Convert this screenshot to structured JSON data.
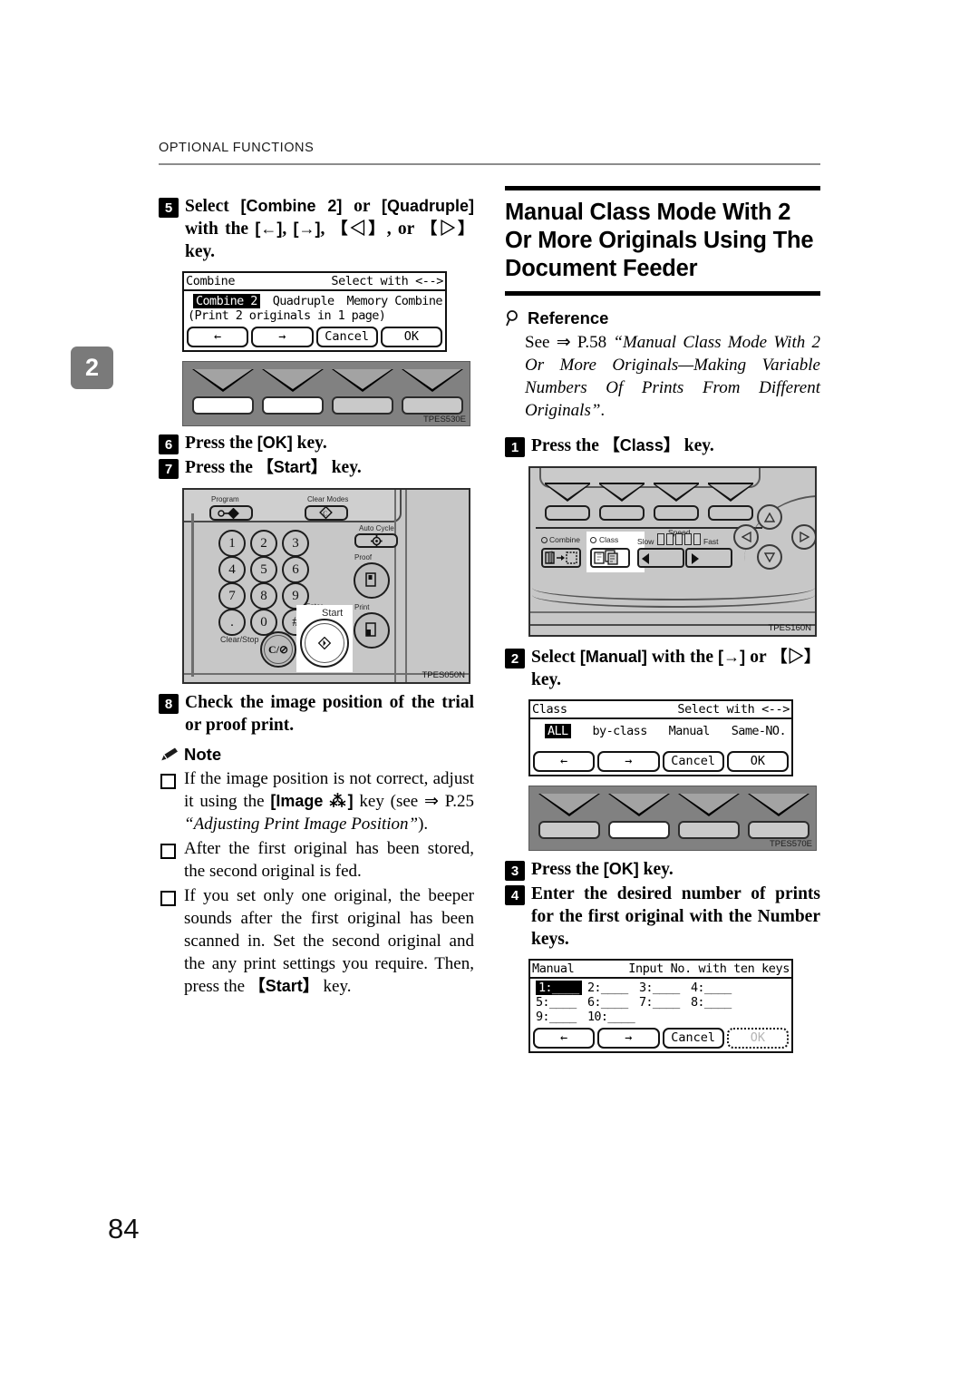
{
  "page": {
    "running_head": "OPTIONAL FUNCTIONS",
    "chapter_tab": "2",
    "folio": "84"
  },
  "left_column": {
    "step5": {
      "num": "5",
      "t1": "Select ",
      "k1": "[Combine 2]",
      "t2": " or ",
      "k2": "[Quadruple]",
      "t3": " with the ",
      "k3": "[←]",
      "t4": ", ",
      "k4": "[→]",
      "t5": ", ",
      "k5": "【◁】",
      "t6": ", or ",
      "k6": "【▷】",
      "t7": " key."
    },
    "lcd_combine": {
      "title": "Combine",
      "hint": "Select with <-->",
      "options": [
        "Combine 2",
        "Quadruple",
        "Memory Combine"
      ],
      "selected": "Combine 2",
      "subtitle": "(Print 2 originals in 1 page)",
      "buttons": [
        "←",
        "→",
        "Cancel",
        "OK"
      ]
    },
    "softpanel": {
      "caption": "TPES530E",
      "lit_keys": [
        true,
        true,
        false,
        false
      ]
    },
    "step6": {
      "num": "6",
      "t1": "Press the ",
      "k1": "[OK]",
      "t2": " key."
    },
    "step7": {
      "num": "7",
      "t1": "Press the ",
      "k1": "【Start】",
      "t2": " key."
    },
    "op_panel": {
      "caption": "TPES050N",
      "label_program": "Program",
      "label_clear_modes": "Clear Modes",
      "label_auto_cycle": "Auto Cycle",
      "label_proof": "Proof",
      "label_print": "Print",
      "label_enter": "Enter",
      "label_start": "Start",
      "label_clear_stop": "Clear/Stop",
      "clear_stop_glyph": "C/⊘",
      "numbers": [
        "1",
        "2",
        "3",
        "4",
        "5",
        "6",
        "7",
        "8",
        "9",
        ".",
        "0",
        "#"
      ]
    },
    "step8": {
      "num": "8",
      "text": "Check the image position of the trial or proof print."
    },
    "note": {
      "label": "Note",
      "items": [
        {
          "t1": "If the image position is not correct, adjust it using the ",
          "k1": "[Image ⁂]",
          "t2": " key (see ⇒ P.25 ",
          "i1": "“Adjusting Print Image Position”",
          "t3": ")."
        },
        {
          "t1": "After the first original has been stored, the second original is fed."
        },
        {
          "t1": "If you set only one original, the beeper sounds after the first original has been scanned in. Set the second original and the any print settings you require. Then, press the ",
          "k1": "【Start】",
          "t2": " key."
        }
      ]
    }
  },
  "right_column": {
    "section_title": "Manual Class Mode With 2 Or More Originals Using The Document Feeder",
    "reference": {
      "label": "Reference",
      "t1": "See ⇒ P.58 ",
      "i1": "“Manual Class Mode With 2 Or More Originals—Making Variable Numbers Of Prints From Different Originals”",
      "t2": "."
    },
    "step1": {
      "num": "1",
      "t1": "Press the ",
      "k1": "【Class】",
      "t2": " key."
    },
    "op_panel2": {
      "caption": "TPES160N",
      "label_combine": "Combine",
      "label_class": "Class",
      "label_speed": "Speed",
      "label_slow": "Slow",
      "label_fast": "Fast"
    },
    "step2": {
      "num": "2",
      "t1": "Select ",
      "k1": "[Manual]",
      "t2": " with the ",
      "k2": "[→]",
      "t3": " or ",
      "k3": "【▷】",
      "t4": " key."
    },
    "lcd_class": {
      "title": "Class",
      "hint": "Select with <-->",
      "options": [
        "ALL",
        "by-class",
        "Manual",
        "Same-NO."
      ],
      "selected": "ALL",
      "buttons": [
        "←",
        "→",
        "Cancel",
        "OK"
      ]
    },
    "softpanel2": {
      "caption": "TPES570E",
      "lit_keys": [
        false,
        true,
        false,
        false
      ]
    },
    "step3": {
      "num": "3",
      "t1": "Press the ",
      "k1": "[OK]",
      "t2": " key."
    },
    "step4": {
      "num": "4",
      "text": "Enter the desired number of prints for the first original with the Number keys."
    },
    "lcd_manual": {
      "title": "Manual",
      "hint": "Input No. with ten keys",
      "slots": [
        "1:____",
        "2:____",
        "3:____",
        "4:____",
        "5:____",
        "6:____",
        "7:____",
        "8:____",
        "9:____",
        "10:____"
      ],
      "selected_slot": "1:____",
      "buttons": [
        "←",
        "→",
        "Cancel",
        "OK"
      ],
      "ok_disabled": true
    }
  }
}
